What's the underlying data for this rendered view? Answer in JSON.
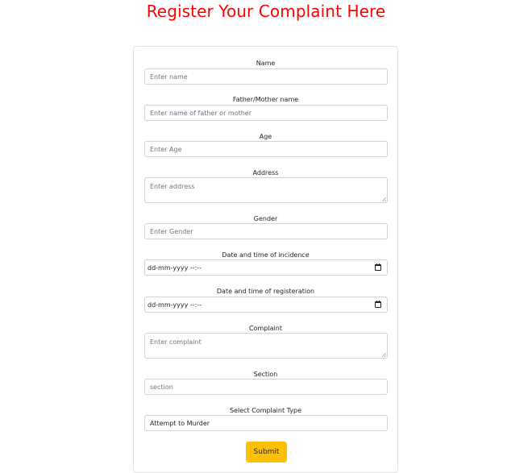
{
  "page_title": "Register Your Complaint Here",
  "form": {
    "name": {
      "label": "Name",
      "placeholder": "Enter name",
      "value": ""
    },
    "parent_name": {
      "label": "Father/Mother name",
      "placeholder": "Enter name of father or mother",
      "value": ""
    },
    "age": {
      "label": "Age",
      "placeholder": "Enter Age",
      "value": ""
    },
    "address": {
      "label": "Address",
      "placeholder": "Enter address",
      "value": ""
    },
    "gender": {
      "label": "Gender",
      "placeholder": "Enter Gender",
      "value": ""
    },
    "incidence_datetime": {
      "label": "Date and time of incidence",
      "value": "dd-mm-yyyy --:--",
      "icon": "calendar-icon"
    },
    "registration_datetime": {
      "label": "Date and time of registeration",
      "value": "dd-mm-yyyy --:--",
      "icon": "calendar-icon"
    },
    "complaint": {
      "label": "Complaint",
      "placeholder": "Enter complaint",
      "value": ""
    },
    "section": {
      "label": "Section",
      "placeholder": "section",
      "value": ""
    },
    "complaint_type": {
      "label": "Select Complaint Type",
      "selected": "Attempt to Murder"
    },
    "submit_label": "Submit"
  },
  "colors": {
    "title": "#ff0000",
    "submit_button": "#ffc107",
    "placeholder": "#6c757d",
    "border": "#ced4da"
  }
}
